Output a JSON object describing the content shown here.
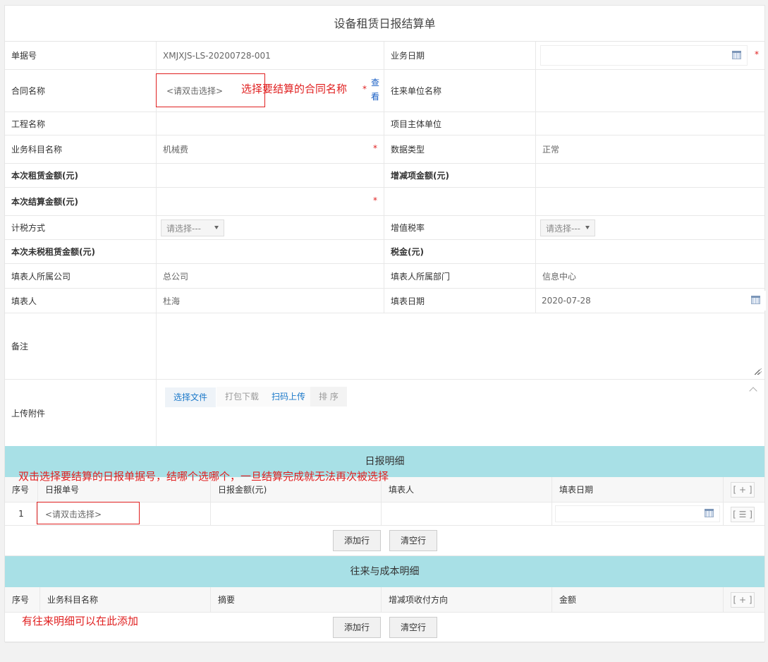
{
  "title": "设备租赁日报结算单",
  "fields": {
    "bill_no_label": "单据号",
    "bill_no_value": "XMJXJS-LS-20200728-001",
    "biz_date_label": "业务日期",
    "contract_label": "合同名称",
    "contract_placeholder": "<请双击选择>",
    "contract_view_1": "查",
    "contract_view_2": "看",
    "partner_label": "往来单位名称",
    "project_label": "工程名称",
    "project_owner_label": "项目主体单位",
    "subject_label": "业务科目名称",
    "subject_value": "机械费",
    "data_type_label": "数据类型",
    "data_type_value": "正常",
    "rent_amount_label": "本次租赁金额(元)",
    "adjust_amount_label": "增减项金额(元)",
    "settle_amount_label": "本次结算金额(元)",
    "tax_method_label": "计税方式",
    "tax_method_value": "请选择---",
    "vat_rate_label": "增值税率",
    "vat_rate_value": "请选择---",
    "untaxed_label": "本次未税租赁金额(元)",
    "tax_label": "税金(元)",
    "company_label": "填表人所属公司",
    "company_value": "总公司",
    "dept_label": "填表人所属部门",
    "dept_value": "信息中心",
    "filler_label": "填表人",
    "filler_value": "杜海",
    "fill_date_label": "填表日期",
    "fill_date_value": "2020-07-28",
    "remark_label": "备注",
    "attach_label": "上传附件",
    "required_mark": "*"
  },
  "upload_buttons": [
    "选择文件",
    "打包下载",
    "扫码上传",
    "排 序"
  ],
  "annotations": {
    "contract_note": "选择要结算的合同名称",
    "daily_note": "双击选择要结算的日报单据号，结哪个选哪个，一旦结算完成就无法再次被选择",
    "cost_note": "有往来明细可以在此添加"
  },
  "daily_section": {
    "title": "日报明细",
    "columns": [
      "序号",
      "日报单号",
      "日报金额(元)",
      "填表人",
      "填表日期"
    ],
    "add_col": "[ + ]",
    "rows": [
      {
        "index": "1",
        "placeholder": "<请双击选择>",
        "menu": "[ ☰ ]"
      }
    ],
    "add_row": "添加行",
    "clear_rows": "清空行"
  },
  "cost_section": {
    "title": "往来与成本明细",
    "columns": [
      "序号",
      "业务科目名称",
      "摘要",
      "增减项收付方向",
      "金额"
    ],
    "add_col": "[ + ]",
    "add_row": "添加行",
    "clear_rows": "清空行"
  },
  "colors": {
    "accent_section": "#a8e0e6",
    "annotation": "#e02020",
    "link": "#1a5fc4"
  }
}
